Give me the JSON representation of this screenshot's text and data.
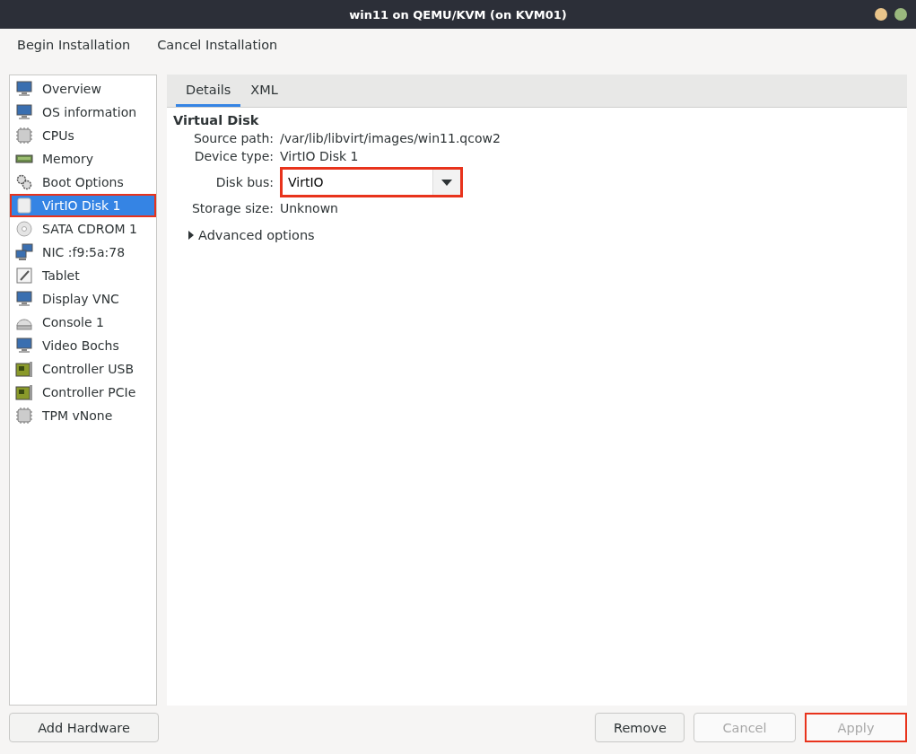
{
  "window": {
    "title": "win11 on QEMU/KVM (on KVM01)"
  },
  "toolbar": [
    {
      "label": "Begin Installation"
    },
    {
      "label": "Cancel Installation"
    }
  ],
  "sidebar": {
    "items": [
      {
        "label": "Overview",
        "kind": "monitor",
        "selected": false,
        "highlighted": false
      },
      {
        "label": "OS information",
        "kind": "monitor",
        "selected": false,
        "highlighted": false
      },
      {
        "label": "CPUs",
        "kind": "chip",
        "selected": false,
        "highlighted": false
      },
      {
        "label": "Memory",
        "kind": "memory",
        "selected": false,
        "highlighted": false
      },
      {
        "label": "Boot Options",
        "kind": "gears",
        "selected": false,
        "highlighted": false
      },
      {
        "label": "VirtIO Disk 1",
        "kind": "disk",
        "selected": true,
        "highlighted": true
      },
      {
        "label": "SATA CDROM 1",
        "kind": "cdrom",
        "selected": false,
        "highlighted": false
      },
      {
        "label": "NIC :f9:5a:78",
        "kind": "network",
        "selected": false,
        "highlighted": false
      },
      {
        "label": "Tablet",
        "kind": "tablet",
        "selected": false,
        "highlighted": false
      },
      {
        "label": "Display VNC",
        "kind": "monitor",
        "selected": false,
        "highlighted": false
      },
      {
        "label": "Console 1",
        "kind": "console",
        "selected": false,
        "highlighted": false
      },
      {
        "label": "Video Bochs",
        "kind": "monitor",
        "selected": false,
        "highlighted": false
      },
      {
        "label": "Controller USB",
        "kind": "card",
        "selected": false,
        "highlighted": false
      },
      {
        "label": "Controller PCIe",
        "kind": "card",
        "selected": false,
        "highlighted": false
      },
      {
        "label": "TPM vNone",
        "kind": "chip",
        "selected": false,
        "highlighted": false
      }
    ]
  },
  "tabs": [
    {
      "label": "Details",
      "selected": true
    },
    {
      "label": "XML",
      "selected": false
    }
  ],
  "details": {
    "heading": "Virtual Disk",
    "fields": [
      {
        "kind": "text",
        "label": "Source path:",
        "value": "/var/lib/libvirt/images/win11.qcow2"
      },
      {
        "kind": "text",
        "label": "Device type:",
        "value": "VirtIO Disk 1"
      },
      {
        "kind": "dropdown",
        "label": "Disk bus:",
        "value": "VirtIO",
        "highlighted": true
      },
      {
        "kind": "text",
        "label": "Storage size:",
        "value": "Unknown"
      }
    ],
    "advanced": {
      "label": "Advanced options",
      "expanded": false
    }
  },
  "add_button": {
    "label": "Add Hardware"
  },
  "buttons": [
    {
      "label": "Remove",
      "disabled": false,
      "highlighted": false
    },
    {
      "label": "Cancel",
      "disabled": true,
      "highlighted": false
    },
    {
      "label": "Apply",
      "disabled": true,
      "highlighted": true
    }
  ]
}
